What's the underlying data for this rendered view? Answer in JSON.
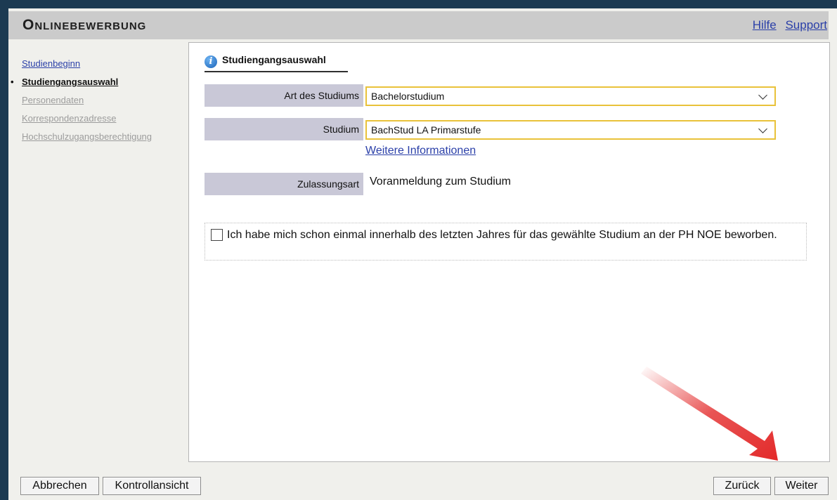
{
  "app": {
    "title": "Onlinebewerbung"
  },
  "header": {
    "links": [
      "Hilfe",
      "Support"
    ]
  },
  "sidebar": {
    "items": [
      {
        "label": "Studienbeginn",
        "state": "link"
      },
      {
        "label": "Studiengangsauswahl",
        "state": "active"
      },
      {
        "label": "Personendaten",
        "state": "disabled"
      },
      {
        "label": "Korrespondenzadresse",
        "state": "disabled"
      },
      {
        "label": "Hochschulzugangsberechtigung",
        "state": "disabled"
      }
    ]
  },
  "section": {
    "title": "Studiengangsauswahl",
    "icon": "info-icon"
  },
  "form": {
    "art": {
      "label": "Art des Studiums",
      "value": "Bachelorstudium"
    },
    "studium": {
      "label": "Studium",
      "value": "BachStud LA Primarstufe"
    },
    "more_info": "Weitere Informationen",
    "zulassung": {
      "label": "Zulassungsart",
      "value": "Voranmeldung zum Studium"
    },
    "checkbox": {
      "label": "Ich habe mich schon einmal innerhalb des letzten Jahres für das gewählte Studium an der PH NOE beworben.",
      "checked": false
    }
  },
  "buttons": {
    "cancel": "Abbrechen",
    "review": "Kontrollansicht",
    "back": "Zurück",
    "next": "Weiter"
  },
  "colors": {
    "accent_arrow": "#e32a2a",
    "link": "#2a3fa8",
    "select_border": "#e9c23a"
  }
}
